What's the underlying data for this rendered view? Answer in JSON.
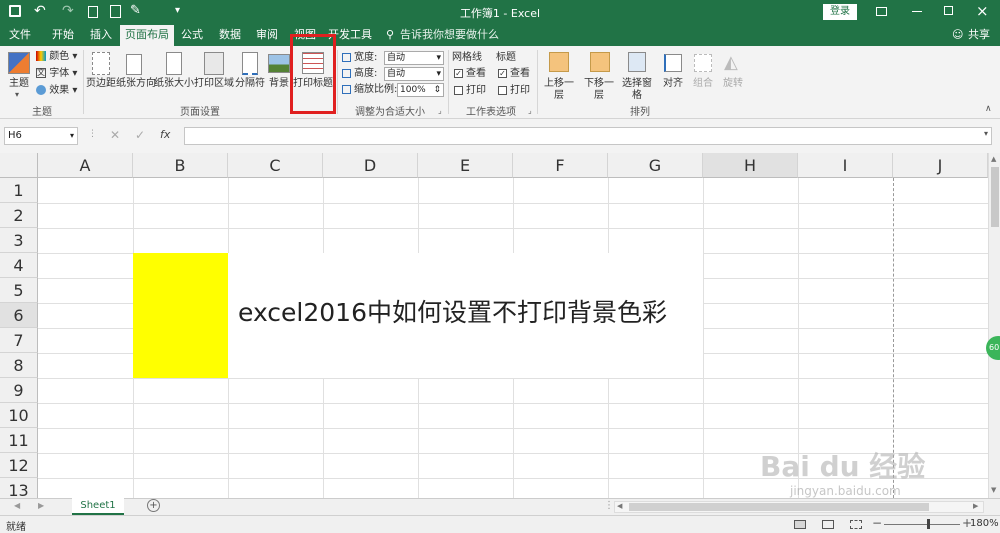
{
  "window": {
    "title": "工作簿1 - Excel",
    "login": "登录"
  },
  "tabs": [
    "文件",
    "开始",
    "插入",
    "页面布局",
    "公式",
    "数据",
    "审阅",
    "视图",
    "开发工具"
  ],
  "tell_me": "告诉我你想要做什么",
  "share": "共享",
  "ribbon": {
    "theme": {
      "main": "主题",
      "colors": "颜色",
      "fonts": "字体",
      "effects": "效果",
      "group": "主题"
    },
    "page_setup": {
      "margins": "页边距",
      "orientation": "纸张方向",
      "size": "纸张大小",
      "print_area": "打印区域",
      "breaks": "分隔符",
      "background": "背景",
      "print_titles": "打印标题",
      "group": "页面设置"
    },
    "scale": {
      "width_label": "宽度:",
      "width_value": "自动",
      "height_label": "高度:",
      "height_value": "自动",
      "scale_label": "缩放比例:",
      "scale_value": "100%",
      "group": "调整为合适大小"
    },
    "sheet_options": {
      "gridlines": "网格线",
      "headings": "标题",
      "view": "查看",
      "print": "打印",
      "group": "工作表选项"
    },
    "arrange": {
      "bring_forward": "上移一层",
      "send_backward": "下移一层",
      "selection_pane": "选择窗格",
      "align": "对齐",
      "group_btn": "组合",
      "rotate": "旋转",
      "group": "排列"
    }
  },
  "formula_bar": {
    "name_box": "H6",
    "fx": "fx",
    "value": ""
  },
  "columns": [
    "A",
    "B",
    "C",
    "D",
    "E",
    "F",
    "G",
    "H",
    "I",
    "J"
  ],
  "rows": [
    "1",
    "2",
    "3",
    "4",
    "5",
    "6",
    "7",
    "8",
    "9",
    "10",
    "11",
    "12",
    "13"
  ],
  "cell_text": "excel2016中如何设置不打印背景色彩",
  "colors": {
    "fill": "#ffff00",
    "accent": "#217346",
    "highlight": "#e02020"
  },
  "sheet_tab": "Sheet1",
  "status": {
    "ready": "就绪",
    "zoom": "180%"
  },
  "watermark": {
    "brand": "Bai du 经验",
    "url": "jingyan.baidu.com"
  },
  "side_badge": "60"
}
